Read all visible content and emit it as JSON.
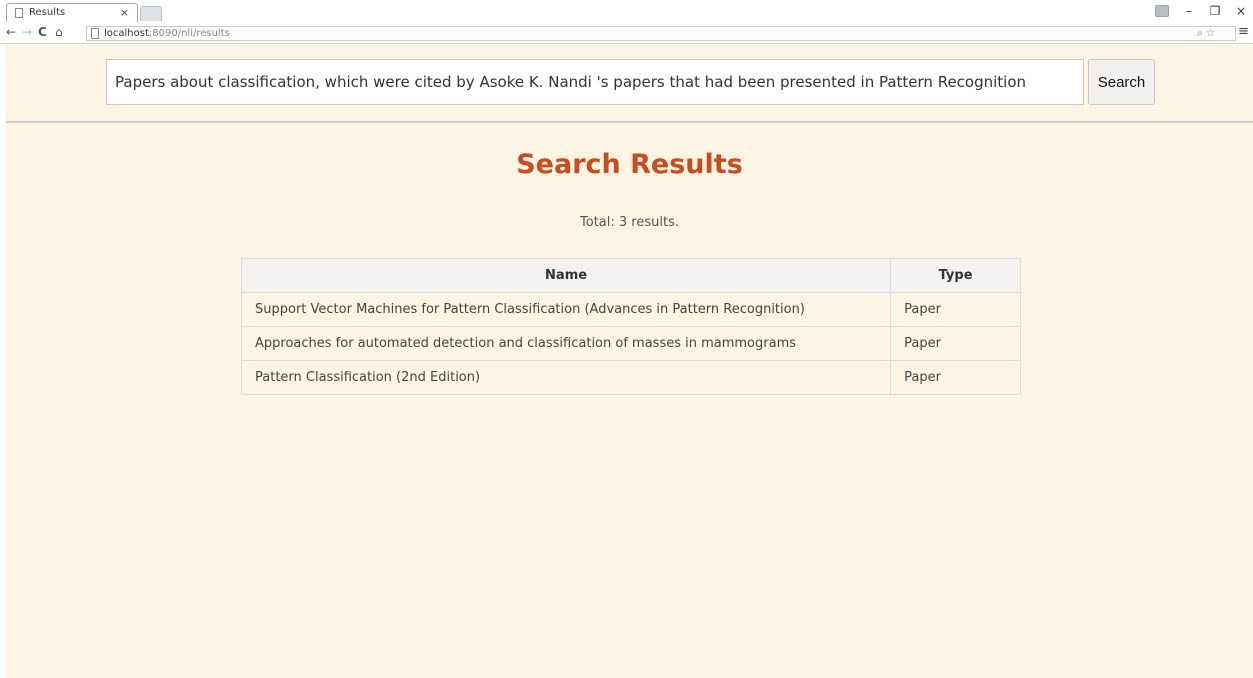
{
  "browser": {
    "tab_title": "Results",
    "tab_close": "×",
    "url_host": "localhost",
    "url_path": ":8090/nli/results",
    "window_controls": {
      "minimize": "–",
      "restore": "❐",
      "close": "×"
    }
  },
  "search": {
    "query": "Papers about classification, which were cited by Asoke K. Nandi 's papers that had been presented in Pattern Recognition",
    "button_label": "Search"
  },
  "results": {
    "title": "Search Results",
    "total_text": "Total: 3 results.",
    "columns": [
      "Name",
      "Type"
    ],
    "rows": [
      {
        "name": "Support Vector Machines for Pattern Classification (Advances in Pattern Recognition)",
        "type": "Paper"
      },
      {
        "name": "Approaches for automated detection and classification of masses in mammograms",
        "type": "Paper"
      },
      {
        "name": "Pattern Classification (2nd Edition)",
        "type": "Paper"
      }
    ]
  },
  "colors": {
    "page_background": "#fdf5e4",
    "title": "#cc4b1c"
  }
}
